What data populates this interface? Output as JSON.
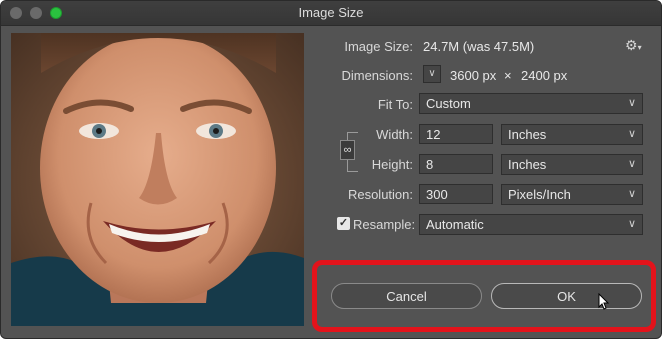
{
  "window": {
    "title": "Image Size"
  },
  "info": {
    "image_size_label": "Image Size:",
    "image_size_value": "24.7M (was 47.5M)",
    "dimensions_label": "Dimensions:",
    "dimensions_w": "3600 px",
    "dimensions_x": "×",
    "dimensions_h": "2400 px"
  },
  "fit_to": {
    "label": "Fit To:",
    "value": "Custom"
  },
  "width": {
    "label": "Width:",
    "value": "12",
    "unit": "Inches"
  },
  "height": {
    "label": "Height:",
    "value": "8",
    "unit": "Inches"
  },
  "resolution": {
    "label": "Resolution:",
    "value": "300",
    "unit": "Pixels/Inch"
  },
  "resample": {
    "label": "Resample:",
    "checked": true,
    "value": "Automatic"
  },
  "buttons": {
    "cancel": "Cancel",
    "ok": "OK"
  },
  "colors": {
    "highlight": "#e3131b",
    "dialog_bg": "#535353",
    "maximize": "#2ac23f"
  }
}
